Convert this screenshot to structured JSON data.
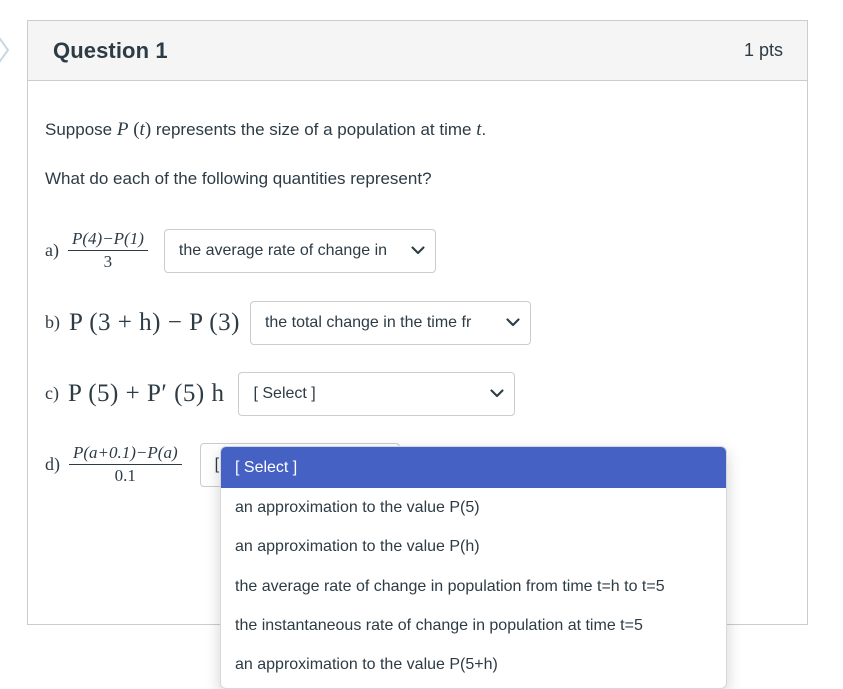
{
  "edge": {
    "icon": "chevron-right-icon"
  },
  "header": {
    "title": "Question 1",
    "points": "1 pts"
  },
  "body": {
    "prompt_line1_before": "Suppose ",
    "prompt_line1_var1": "P",
    "prompt_line1_mid": " (",
    "prompt_line1_var2": "t",
    "prompt_line1_close": ")",
    "prompt_line1_after": " represents the size of a population at time ",
    "prompt_line1_var3": "t",
    "prompt_line1_period": ".",
    "prompt_line2": "What do each of the following quantities represent?"
  },
  "answers": [
    {
      "label": "a)",
      "expr_type": "fraction",
      "numerator": "P(4)−P(1)",
      "denominator": "3",
      "select_value": "the average rate of change in",
      "caret": "chevron-down-icon"
    },
    {
      "label": "b)",
      "expr_type": "inline",
      "expression": "P (3 + h) − P (3)",
      "select_value": "the total change in the time fr",
      "caret": "chevron-down-icon"
    },
    {
      "label": "c)",
      "expr_type": "inline",
      "expression": "P (5) + P′ (5) h",
      "select_value": "[ Select ]",
      "caret": "chevron-down-icon"
    },
    {
      "label": "d)",
      "expr_type": "fraction",
      "numerator": "P(a+0.1)−P(a)",
      "denominator": "0.1",
      "select_value": "[ Select ]",
      "caret": "chevron-down-icon"
    }
  ],
  "dropdown": {
    "open_for": "c",
    "highlight_color": "#4561c4",
    "options": [
      "[ Select ]",
      "an approximation to the value P(5)",
      "an approximation to the value P(h)",
      "the average rate of change in population from time t=h to t=5",
      "the instantaneous rate of change in population at time t=5",
      "an approximation to the value P(5+h)"
    ],
    "selected_index": 0
  }
}
